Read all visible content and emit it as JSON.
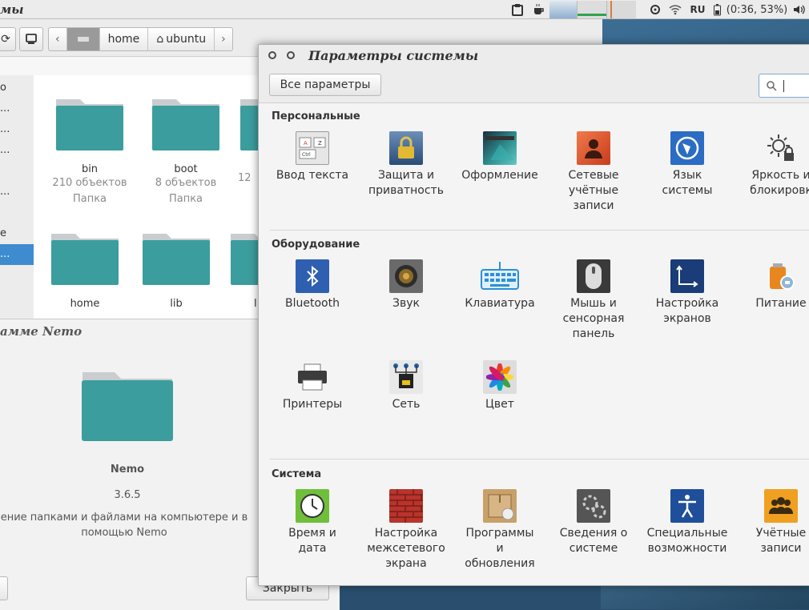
{
  "topbar": {
    "app_title": "мы",
    "lang": "RU",
    "battery": "(0:36, 53%)",
    "icons": [
      "clipboard-icon",
      "coffee-icon",
      "system-monitor-icon",
      "network-icon",
      "wifi-icon",
      "battery-icon",
      "volume-icon"
    ]
  },
  "file_manager": {
    "breadcrumb": [
      "home",
      "ubuntu"
    ],
    "sidebar_items": [
      "о",
      "...",
      "...",
      "...",
      "",
      "...",
      "",
      "е",
      "..."
    ],
    "files": [
      {
        "name": "bin",
        "count": "210 объектов",
        "type": "Папка"
      },
      {
        "name": "boot",
        "count": "8 объектов",
        "type": "Папка"
      },
      {
        "name": "",
        "count": "12",
        "type": ""
      },
      {
        "name": "home",
        "count": "",
        "type": ""
      },
      {
        "name": "lib",
        "count": "",
        "type": ""
      },
      {
        "name": "l",
        "count": "",
        "type": ""
      }
    ]
  },
  "about": {
    "title": "амме Nemo",
    "name": "Nemo",
    "version": "3.6.5",
    "description_line1": "ение папками и файлами на компьютере и в",
    "description_line2": "помощью Nemo",
    "close_label": "Закрыть"
  },
  "settings": {
    "title": "Параметры системы",
    "all_button": "Все параметры",
    "sections": [
      {
        "title": "Персональные",
        "items": [
          {
            "label1": "Ввод текста",
            "label2": "",
            "label3": "",
            "icon": "keyboard-input-icon"
          },
          {
            "label1": "Защита и",
            "label2": "приватность",
            "label3": "",
            "icon": "security-privacy-icon"
          },
          {
            "label1": "Оформление",
            "label2": "",
            "label3": "",
            "icon": "appearance-icon"
          },
          {
            "label1": "Сетевые",
            "label2": "учётные",
            "label3": "записи",
            "icon": "online-accounts-icon"
          },
          {
            "label1": "Язык",
            "label2": "системы",
            "label3": "",
            "icon": "language-icon"
          },
          {
            "label1": "Яркость и",
            "label2": "блокировк",
            "label3": "",
            "icon": "brightness-lock-icon"
          }
        ]
      },
      {
        "title": "Оборудование",
        "items": [
          {
            "label1": "Bluetooth",
            "label2": "",
            "label3": "",
            "icon": "bluetooth-icon"
          },
          {
            "label1": "Звук",
            "label2": "",
            "label3": "",
            "icon": "sound-icon"
          },
          {
            "label1": "Клавиатура",
            "label2": "",
            "label3": "",
            "icon": "keyboard-icon"
          },
          {
            "label1": "Мышь и",
            "label2": "сенсорная",
            "label3": "панель",
            "icon": "mouse-icon"
          },
          {
            "label1": "Настройка",
            "label2": "экранов",
            "label3": "",
            "icon": "displays-icon"
          },
          {
            "label1": "Питание",
            "label2": "",
            "label3": "",
            "icon": "power-icon"
          },
          {
            "label1": "Принтеры",
            "label2": "",
            "label3": "",
            "icon": "printer-icon"
          },
          {
            "label1": "Сеть",
            "label2": "",
            "label3": "",
            "icon": "network-icon"
          },
          {
            "label1": "Цвет",
            "label2": "",
            "label3": "",
            "icon": "color-icon"
          }
        ]
      },
      {
        "title": "Система",
        "items": [
          {
            "label1": "Время и",
            "label2": "дата",
            "label3": "",
            "icon": "clock-icon"
          },
          {
            "label1": "Настройка",
            "label2": "межсетевого",
            "label3": "экрана",
            "icon": "firewall-icon"
          },
          {
            "label1": "Программы",
            "label2": "и",
            "label3": "обновления",
            "icon": "software-updates-icon"
          },
          {
            "label1": "Сведения о",
            "label2": "системе",
            "label3": "",
            "icon": "system-info-icon"
          },
          {
            "label1": "Специальные",
            "label2": "возможности",
            "label3": "",
            "icon": "accessibility-icon"
          },
          {
            "label1": "Учётные",
            "label2": "записи",
            "label3": "",
            "icon": "user-accounts-icon"
          }
        ]
      }
    ]
  },
  "colors": {
    "folder": "#3a9e9e",
    "accent": "#3f8bd0",
    "panel": "#ececec"
  }
}
